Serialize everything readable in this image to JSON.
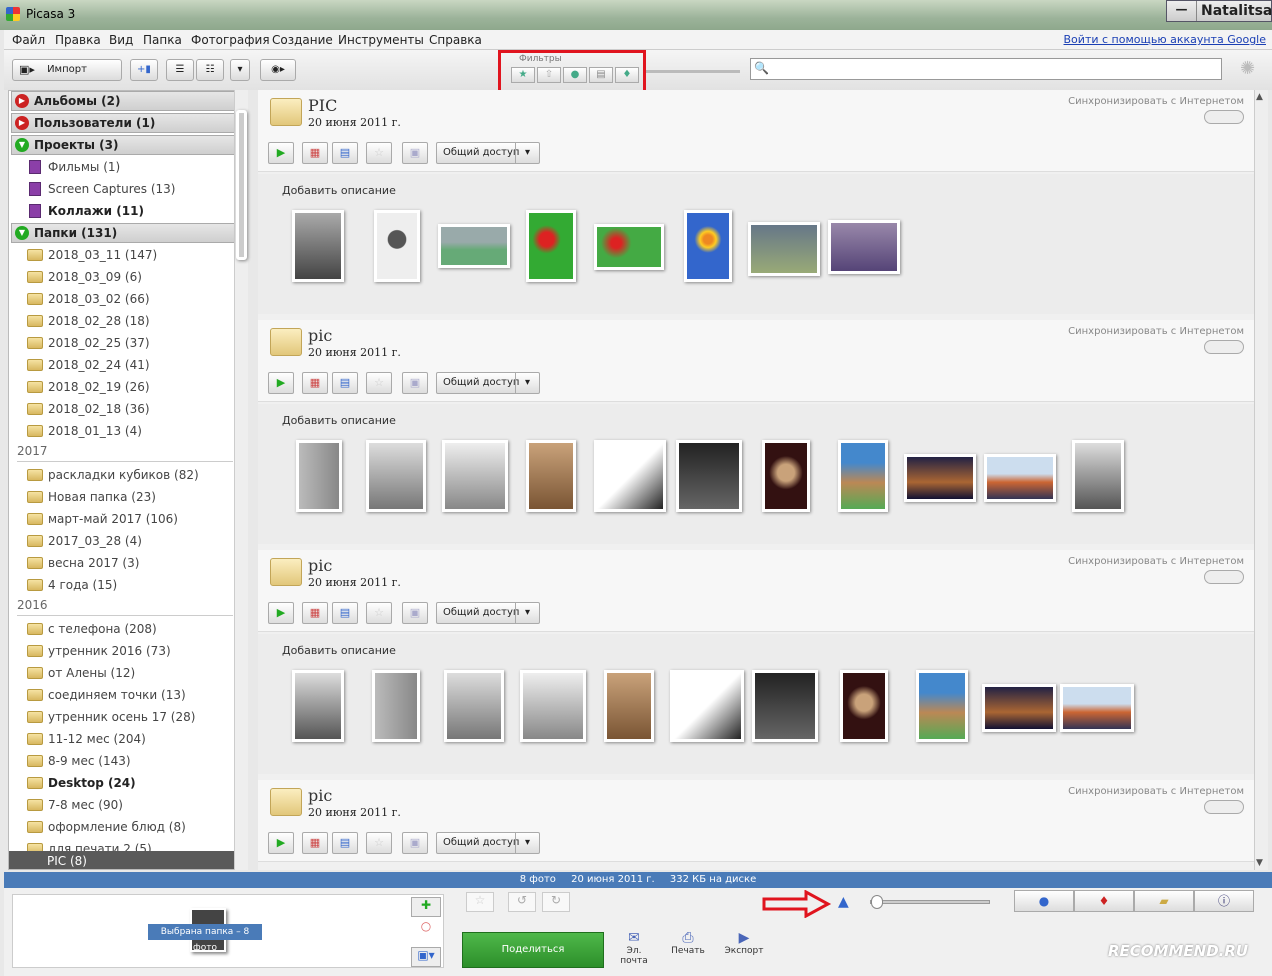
{
  "window": {
    "title": "Picasa 3",
    "user": "Natalitsa"
  },
  "menu": {
    "items": [
      "Файл",
      "Правка",
      "Вид",
      "Папка",
      "Фотография",
      "Создание",
      "Инструменты",
      "Справка"
    ],
    "login": "Войти с помощью аккаунта Google"
  },
  "toolbar": {
    "import_label": "Импорт",
    "filters_label": "Фильтры"
  },
  "search": {
    "placeholder": ""
  },
  "sidebar": {
    "albums": "Альбомы (2)",
    "users": "Пользователи (1)",
    "projects": "Проекты (3)",
    "project_items": [
      "Фильмы (1)",
      "Screen Captures (13)",
      "Коллажи (11)"
    ],
    "folders": "Папки (131)",
    "folders_top": [
      "2018_03_11 (147)",
      "2018_03_09 (6)",
      "2018_03_02 (66)",
      "2018_02_28 (18)",
      "2018_02_25 (37)",
      "2018_02_24 (41)",
      "2018_02_19 (26)",
      "2018_02_18 (36)",
      "2018_01_13 (4)"
    ],
    "year_2017": "2017",
    "folders_2017": [
      "раскладки кубиков (82)",
      "Новая папка (23)",
      "март-май 2017 (106)",
      "2017_03_28 (4)",
      "весна 2017 (3)",
      "4 года (15)"
    ],
    "year_2016": "2016",
    "folders_2016": [
      "с телефона (208)",
      "утренник 2016 (73)",
      "от Алены (12)",
      "соединяем точки (13)",
      "утренник осень 17 (28)",
      "11-12 мес (204)",
      "8-9 мес (143)",
      "Desktop (24)",
      "7-8 мес (90)",
      "оформление блюд (8)",
      "для печати 2 (5)"
    ],
    "selected": "PIC (8)"
  },
  "albums": [
    {
      "name": "PIC",
      "date": "20 июня 2011 г.",
      "sync": "Синхронизировать с Интернетом",
      "share": "Общий доступ",
      "desc": "Добавить описание"
    },
    {
      "name": "pic",
      "date": "20 июня 2011 г.",
      "sync": "Синхронизировать с Интернетом",
      "share": "Общий доступ",
      "desc": "Добавить описание"
    },
    {
      "name": "pic",
      "date": "20 июня 2011 г.",
      "sync": "Синхронизировать с Интернетом",
      "share": "Общий доступ",
      "desc": "Добавить описание"
    },
    {
      "name": "pic",
      "date": "20 июня 2011 г.",
      "sync": "Синхронизировать с Интернетом",
      "share": "Общий доступ",
      "desc": ""
    }
  ],
  "status": {
    "count": "8 фото",
    "date": "20 июня 2011 г.",
    "size": "332 КБ на диске"
  },
  "tray": {
    "selected_badge": "Выбрана папка – 8 фото",
    "share_button": "Поделиться",
    "email": "Эл. почта",
    "print": "Печать",
    "export": "Экспорт"
  },
  "watermark": "RECOMMEND.RU",
  "colors": {
    "highlight_red": "#e0141e",
    "status_blue": "#4a7bb8",
    "share_green": "#2d8f2a"
  }
}
